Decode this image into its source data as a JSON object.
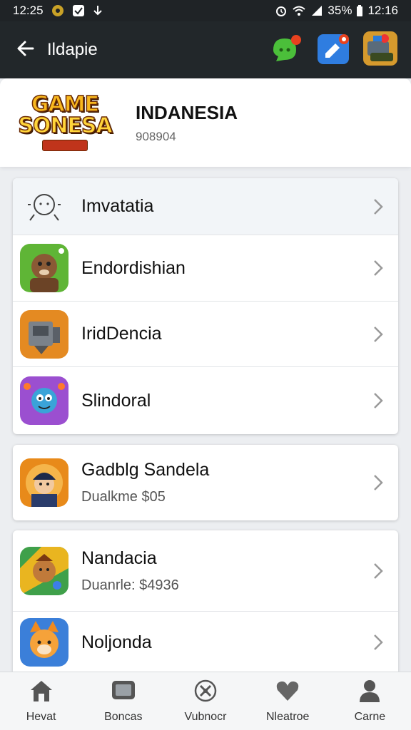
{
  "status_bar": {
    "time": "12:25",
    "battery_pct": "35%",
    "right_time": "12:16",
    "icons": [
      "game-notify-icon",
      "checkbox-icon",
      "download-icon",
      "alarm-icon",
      "wifi-icon",
      "signal-icon",
      "battery-icon"
    ]
  },
  "app_bar": {
    "title": "Ildapie",
    "actions": [
      "chat-icon",
      "camera-icon",
      "game-app-icon"
    ],
    "bg_color": "#22272a"
  },
  "header": {
    "logo_line1": "GAME",
    "logo_line2": "SONESA",
    "title": "INDANESIA",
    "subtitle": "908904"
  },
  "menu_list": [
    {
      "label": "Imvatatia",
      "icon": "person-outline-icon"
    },
    {
      "label": "Endordishian",
      "icon": "beaver-game-icon"
    },
    {
      "label": "IridDencia",
      "icon": "machine-game-icon"
    },
    {
      "label": "Slindoral",
      "icon": "monster-game-icon"
    }
  ],
  "featured": [
    {
      "title": "Gadblg Sandela",
      "subtitle": "Dualkme $05",
      "icon": "captain-game-icon"
    },
    {
      "title": "Nandacia",
      "subtitle": "Duanrle: $4936",
      "icon": "warrior-game-icon"
    },
    {
      "title": "Noljonda",
      "subtitle": "",
      "icon": "fox-game-icon"
    }
  ],
  "bottom_nav": [
    {
      "label": "Hevat",
      "icon": "home-icon"
    },
    {
      "label": "Boncas",
      "icon": "tv-icon"
    },
    {
      "label": "Vubnocr",
      "icon": "games-icon"
    },
    {
      "label": "Nleatroe",
      "icon": "heart-icon"
    },
    {
      "label": "Carne",
      "icon": "profile-icon"
    }
  ]
}
